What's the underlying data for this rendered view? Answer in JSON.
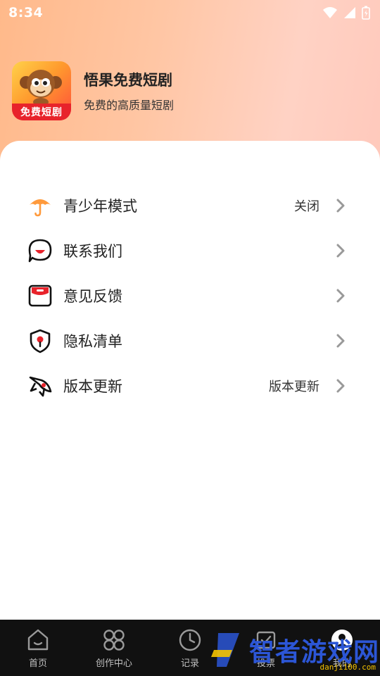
{
  "status_bar": {
    "time": "8:34"
  },
  "app": {
    "name": "悟果免费短剧",
    "subtitle": "免费的高质量短剧",
    "logo_band_text": "免费短剧"
  },
  "menu": [
    {
      "label": "青少年模式",
      "value": "关闭",
      "icon": "umbrella-icon"
    },
    {
      "label": "联系我们",
      "value": "",
      "icon": "chat-bubble-icon"
    },
    {
      "label": "意见反馈",
      "value": "",
      "icon": "feedback-box-icon"
    },
    {
      "label": "隐私清单",
      "value": "",
      "icon": "privacy-shield-icon"
    },
    {
      "label": "版本更新",
      "value": "版本更新",
      "icon": "rocket-icon"
    }
  ],
  "bottom_nav": [
    {
      "label": "首页",
      "icon": "home-icon"
    },
    {
      "label": "创作中心",
      "icon": "grid-icon"
    },
    {
      "label": "记录",
      "icon": "clock-icon"
    },
    {
      "label": "投票",
      "icon": "vote-icon"
    },
    {
      "label": "我的",
      "icon": "profile-icon"
    }
  ],
  "watermark": {
    "text": "智者游戏网",
    "url": "danji100.com"
  },
  "colors": {
    "accent_orange": "#ff9a3c",
    "header_gradient_start": "#ffb98a",
    "header_gradient_end": "#ffc9bc",
    "nav_background": "#111111",
    "watermark_blue": "#2c56d6"
  }
}
